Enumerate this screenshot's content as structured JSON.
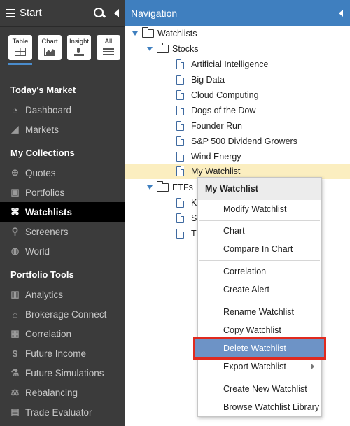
{
  "sidebar": {
    "header": {
      "start_label": "Start"
    },
    "view_buttons": [
      {
        "label": "Table",
        "icon": "table-icon"
      },
      {
        "label": "Chart",
        "icon": "chart-icon"
      },
      {
        "label": "Insight",
        "icon": "insight-icon"
      },
      {
        "label": "All",
        "icon": "list-icon"
      }
    ],
    "sections": [
      {
        "title": "Today's Market",
        "items": [
          {
            "label": "Dashboard",
            "icon": "dashboard-icon"
          },
          {
            "label": "Markets",
            "icon": "markets-chart-icon"
          }
        ]
      },
      {
        "title": "My Collections",
        "items": [
          {
            "label": "Quotes",
            "icon": "quotes-search-icon"
          },
          {
            "label": "Portfolios",
            "icon": "briefcase-icon"
          },
          {
            "label": "Watchlists",
            "icon": "binoculars-icon",
            "active": true
          },
          {
            "label": "Screeners",
            "icon": "magnifier-icon"
          },
          {
            "label": "World",
            "icon": "globe-icon"
          }
        ]
      },
      {
        "title": "Portfolio Tools",
        "items": [
          {
            "label": "Analytics",
            "icon": "bar-chart-icon"
          },
          {
            "label": "Brokerage Connect",
            "icon": "bank-icon"
          },
          {
            "label": "Correlation",
            "icon": "grid-icon"
          },
          {
            "label": "Future Income",
            "icon": "dollar-icon"
          },
          {
            "label": "Future Simulations",
            "icon": "simulation-icon"
          },
          {
            "label": "Rebalancing",
            "icon": "scale-icon"
          },
          {
            "label": "Trade Evaluator",
            "icon": "toolbox-icon"
          }
        ]
      }
    ]
  },
  "navigation": {
    "title": "Navigation",
    "root": "Watchlists",
    "stocks_folder": "Stocks",
    "stocks_items": [
      "Artificial Intelligence",
      "Big Data",
      "Cloud Computing",
      "Dogs of the Dow",
      "Founder Run",
      "S&P 500 Dividend Growers",
      "Wind Energy",
      "My Watchlist"
    ],
    "selected_item": "My Watchlist",
    "etfs_folder": "ETFs",
    "etfs_items_visible_prefix": [
      "K",
      "S",
      "T"
    ]
  },
  "context_menu": {
    "title": "My Watchlist",
    "groups": [
      [
        "Modify Watchlist"
      ],
      [
        "Chart",
        "Compare In Chart"
      ],
      [
        "Correlation",
        "Create Alert"
      ],
      [
        "Rename Watchlist",
        "Copy Watchlist",
        "Delete Watchlist",
        "Export Watchlist"
      ],
      [
        "Create New Watchlist",
        "Browse Watchlist Library"
      ]
    ],
    "highlighted_item": "Delete Watchlist",
    "submenu_item": "Export Watchlist"
  },
  "colors": {
    "sidebar_bg": "#3b3b3b",
    "nav_header": "#3f7fbf",
    "selected_row": "#fbeec0",
    "menu_highlight": "#6d93c6",
    "highlight_outline": "#e02a1f"
  }
}
